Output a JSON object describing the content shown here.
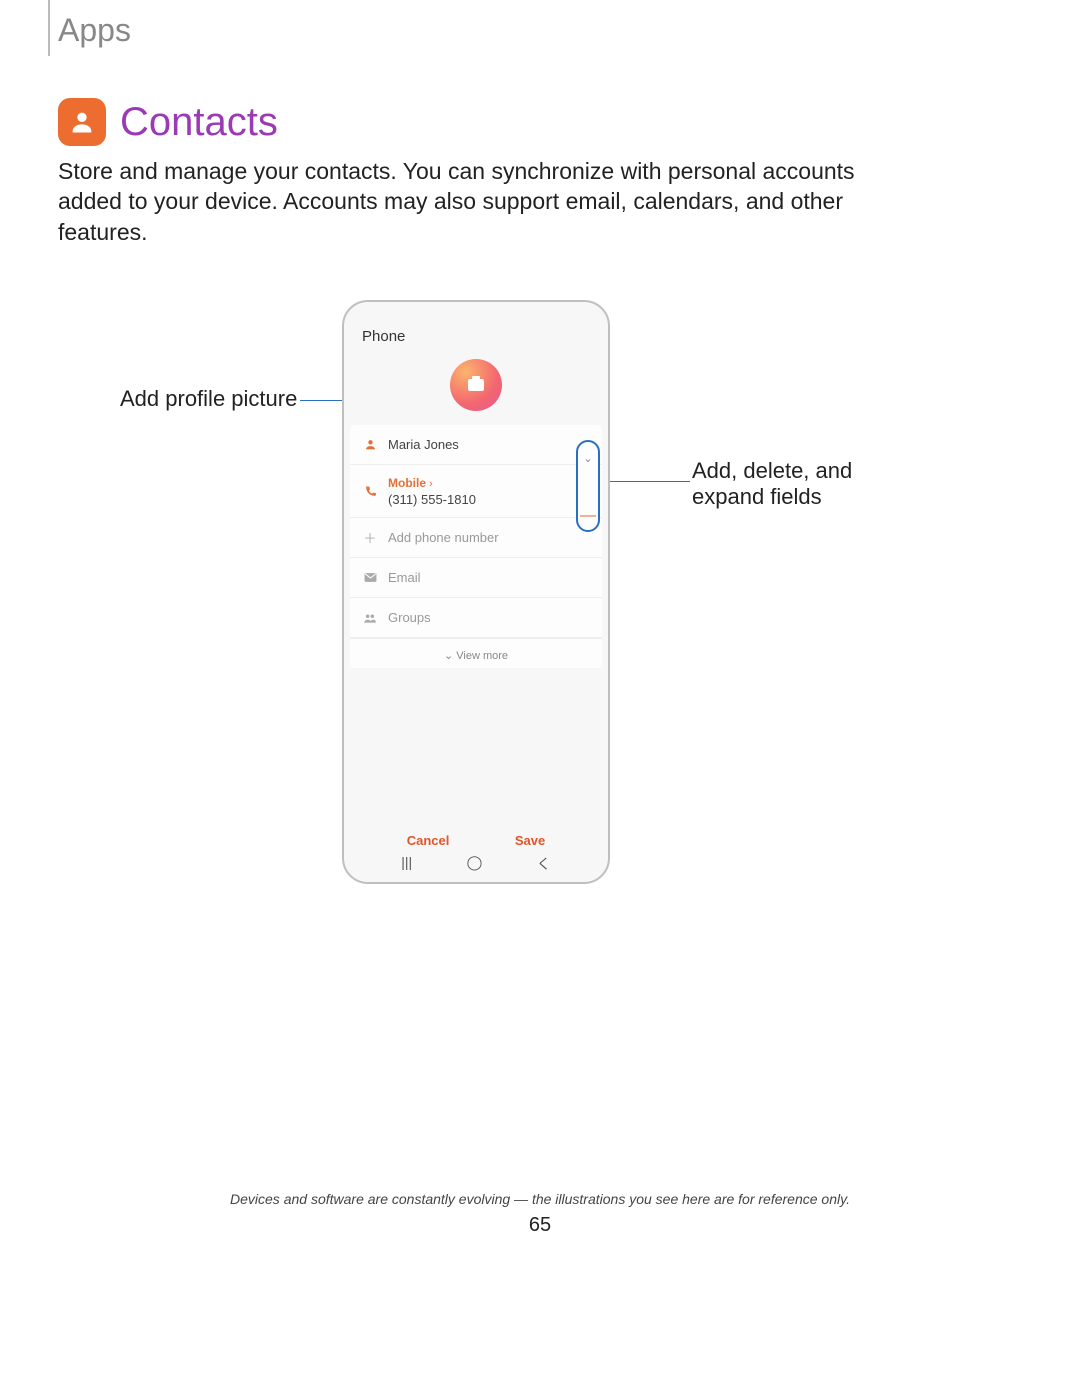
{
  "header": {
    "section": "Apps"
  },
  "title": "Contacts",
  "intro": "Store and manage your contacts. You can synchronize with personal accounts added to your device. Accounts may also support email, calendars, and other features.",
  "callouts": {
    "left": "Add profile picture",
    "right": "Add, delete, and expand fields"
  },
  "phone": {
    "storage_label": "Phone",
    "contact_name": "Maria Jones",
    "mobile_label": "Mobile",
    "mobile_number": "(311) 555-1810",
    "add_phone": "Add phone number",
    "email": "Email",
    "groups": "Groups",
    "view_more": "View more",
    "cancel": "Cancel",
    "save": "Save"
  },
  "footnote": "Devices and software are constantly evolving — the illustrations you see here are for reference only.",
  "page_number": "65"
}
